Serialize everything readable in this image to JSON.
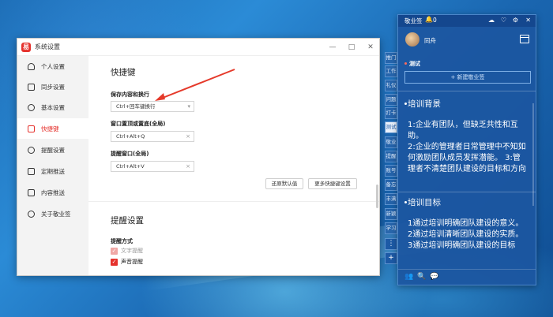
{
  "settings_window": {
    "title": "系统设置",
    "app_logo": "易",
    "controls": [
      "—",
      "□",
      "✕"
    ],
    "sidebar": [
      {
        "label": "个人设置",
        "icon": "person-icon"
      },
      {
        "label": "同步设置",
        "icon": "sync-icon"
      },
      {
        "label": "基本设置",
        "icon": "settings-icon"
      },
      {
        "label": "快捷键",
        "icon": "keyboard-icon"
      },
      {
        "label": "提醒设置",
        "icon": "bell-icon"
      },
      {
        "label": "定期推送",
        "icon": "calendar-icon"
      },
      {
        "label": "内容推送",
        "icon": "content-icon"
      },
      {
        "label": "关于敬业签",
        "icon": "about-icon"
      }
    ],
    "active_index": 3,
    "hotkeys": {
      "section_title": "快捷键",
      "save_label": "保存内容和换行",
      "save_value": "Ctrl+回车键换行",
      "save_suffix": "▾",
      "topmost_label": "窗口置顶或置底(全局)",
      "topmost_value": "Ctrl+Alt+Q",
      "remind_label": "提醒窗口(全局)",
      "remind_value": "Ctrl+Alt+V",
      "clear_symbol": "×",
      "restore_button": "还原默认值",
      "more_button": "更多快捷键设置"
    },
    "reminder": {
      "section_title": "提醒设置",
      "mode_label": "提醒方式",
      "text_reminder": "文字提醒",
      "sound_reminder": "声音提醒",
      "checkmark": "✓"
    }
  },
  "notes_panel": {
    "title": "敬业签",
    "count": "0",
    "bell": "🔔",
    "header_icons": [
      "☁",
      "♡",
      "⚙",
      "✕"
    ],
    "username": "同舟",
    "section": "测试",
    "new_button": "+ 新建敬业签",
    "note1_heading": "培训背景",
    "note1_body": "1:企业有团队，但缺乏共性和互助。\n2:企业的管理者日常管理中不知如何激励团队成员发挥潜能。 3:管理者不清楚团队建设的目标和方向",
    "note2_heading": "培训目标",
    "note2_body": "1通过培训明确团队建设的意义。\n2通过培训清晰团队建设的实质。\n3通过培训明确团队建设的目标",
    "footer_icons": [
      "👥",
      "🔍",
      "💬"
    ]
  },
  "side_tabs": [
    "推门",
    "工作",
    "礼仪",
    "问题",
    "打卡",
    "测试",
    "敬业",
    "提醒",
    "账号",
    "备忘",
    "丰满",
    "新颖",
    "学习"
  ],
  "side_tab_active": 5,
  "side_controls": [
    "⋮",
    "+"
  ]
}
